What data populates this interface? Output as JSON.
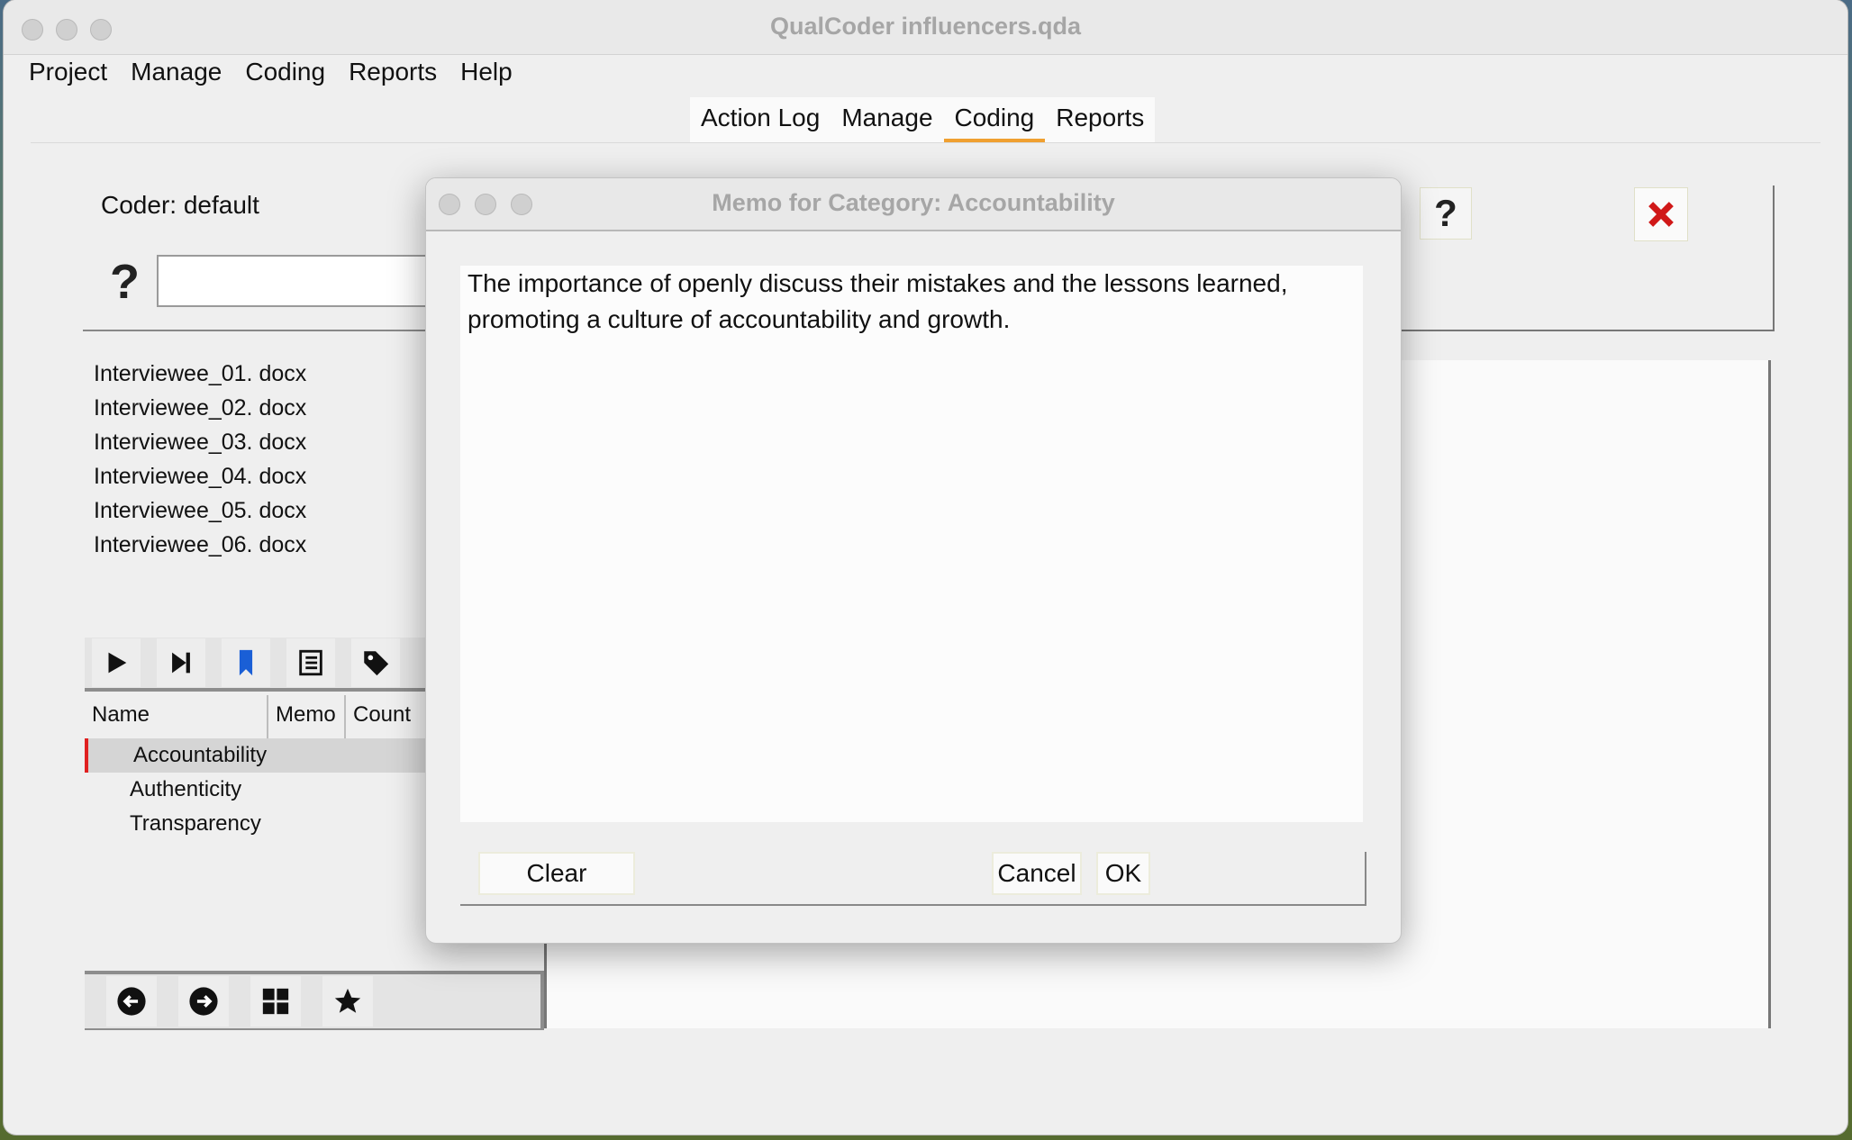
{
  "window": {
    "title": "QualCoder influencers.qda"
  },
  "menu": [
    "Project",
    "Manage",
    "Coding",
    "Reports",
    "Help"
  ],
  "tabs": [
    "Action Log",
    "Manage",
    "Coding",
    "Reports"
  ],
  "active_tab": "Coding",
  "coder": {
    "label": "Coder:",
    "value": "default"
  },
  "search": {
    "value": "",
    "placeholder": ""
  },
  "files": [
    "Interviewee_01. docx",
    "Interviewee_02. docx",
    "Interviewee_03. docx",
    "Interviewee_04. docx",
    "Interviewee_05. docx",
    "Interviewee_06. docx"
  ],
  "tree": {
    "columns": [
      "Name",
      "Memo",
      "Count"
    ],
    "rows": [
      "Accountability",
      "Authenticity",
      "Transparency"
    ],
    "selected": "Accountability"
  },
  "dialog": {
    "title": "Memo for Category: Accountability",
    "memo_text": "The importance of openly discuss their mistakes and the lessons learned, promoting a culture of accountability and growth.",
    "clear_label": "Clear",
    "cancel_label": "Cancel",
    "ok_label": "OK"
  },
  "colors": {
    "active_tab_underline": "#f0a030",
    "selection_marker": "#e02020",
    "close_x": "#d01818",
    "bookmark": "#1a5fd6"
  },
  "icons": {
    "toolbar": [
      "play-icon",
      "skip-next-icon",
      "bookmark-icon",
      "notes-icon",
      "tag-icon"
    ],
    "bottom": [
      "arrow-left-icon",
      "arrow-right-icon",
      "grid-icon",
      "star-icon"
    ]
  }
}
